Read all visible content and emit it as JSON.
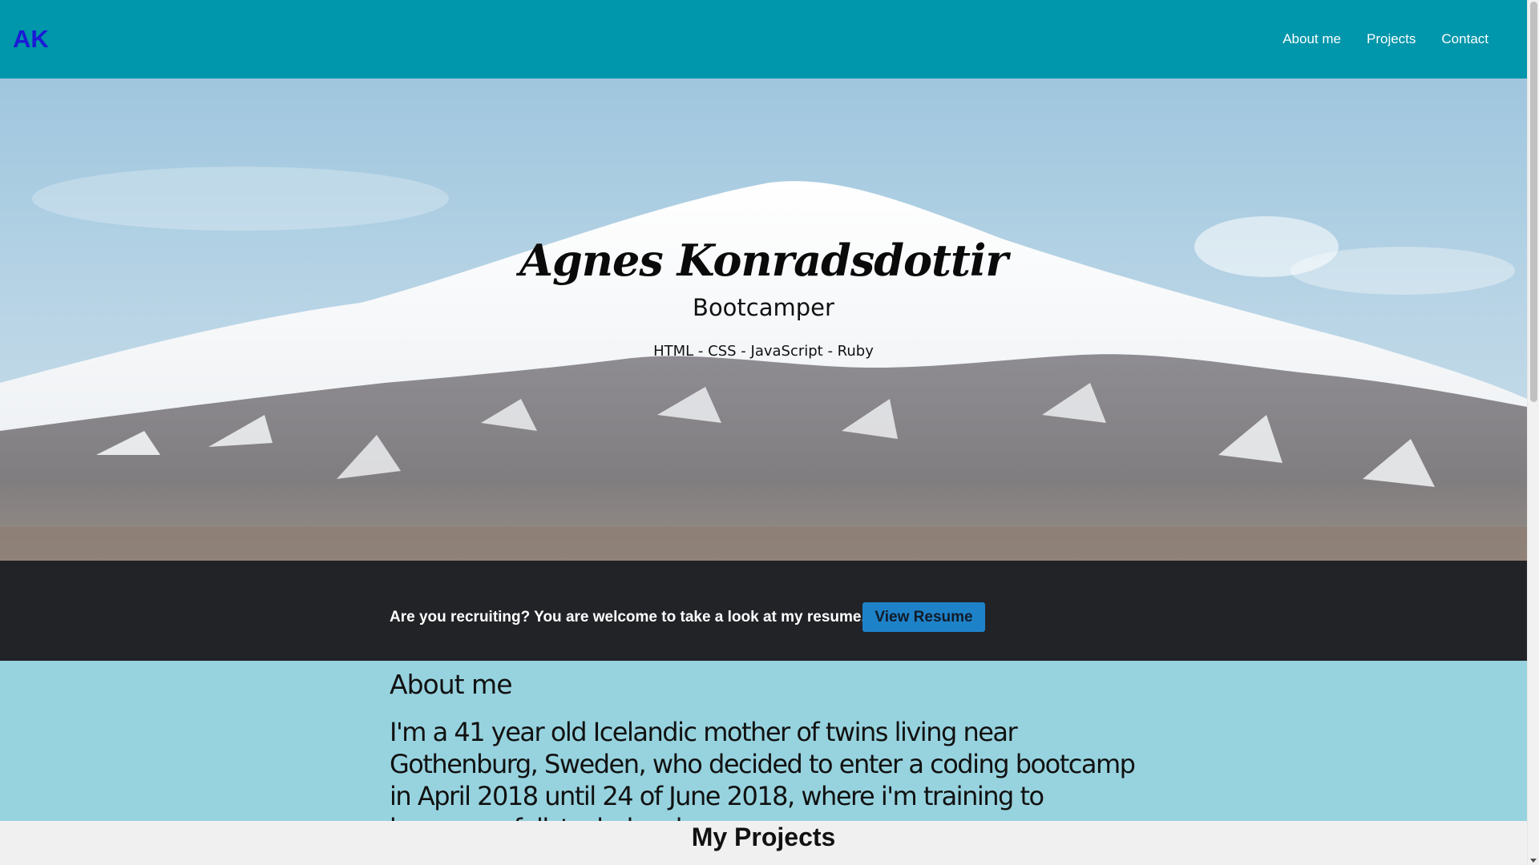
{
  "navbar": {
    "brand": "AK",
    "links": [
      "About me",
      "Projects",
      "Contact"
    ],
    "background": "#0096ab",
    "brand_color": "#1a1ad6"
  },
  "hero": {
    "name": "Agnes Konradsdottir",
    "role": "Bootcamper",
    "skills": "HTML - CSS - JavaScript - Ruby",
    "background_image": "snow-capped-mountain-photo"
  },
  "resume": {
    "text": "Are you recruiting? You are welcome to take a look at my resume.",
    "button_label": "View Resume",
    "band_color": "#222327",
    "button_color": "#1e82c8"
  },
  "about": {
    "title": "About me",
    "body": "I'm a 41 year old Icelandic mother of twins living near Gothenburg, Sweden, who decided to enter a coding bootcamp in April 2018 until 24 of June 2018, where i'm training to become a fullstack developer.",
    "background": "#97d3df"
  },
  "projects": {
    "title": "My Projects"
  }
}
